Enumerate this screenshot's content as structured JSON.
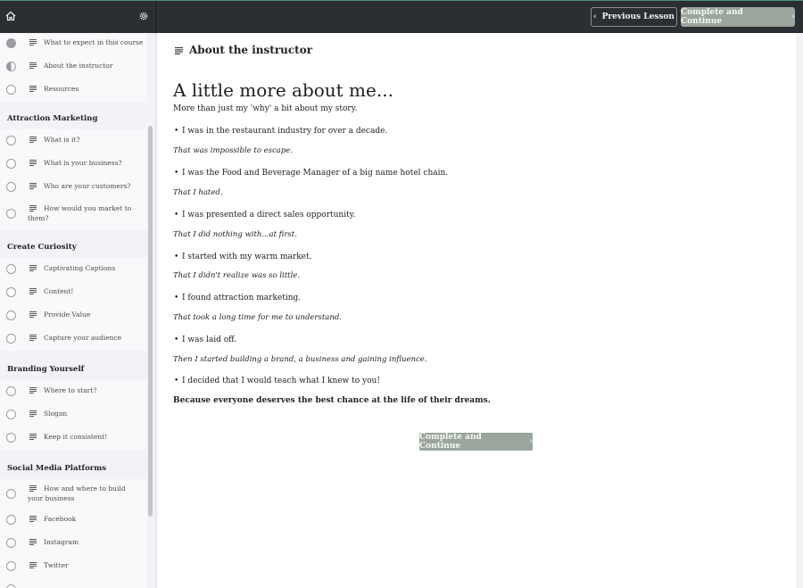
{
  "topbar": {
    "prev_label": "Previous Lesson",
    "complete_label": "Complete and Continue"
  },
  "sidebar": {
    "intro_lessons": [
      {
        "label": "What to expect in this course",
        "status": "done"
      },
      {
        "label": "About the instructor",
        "status": "current"
      },
      {
        "label": "Resources",
        "status": "todo"
      }
    ],
    "sections": [
      {
        "title": "Attraction Marketing",
        "lessons": [
          "What is it?",
          "What is your business?",
          "Who are your customers?",
          "How would you market to them?"
        ]
      },
      {
        "title": "Create Curiosity",
        "lessons": [
          "Captivating Captions",
          "Content!",
          "Provide Value",
          "Capture your audience"
        ]
      },
      {
        "title": "Branding Yourself",
        "lessons": [
          "Where to start?",
          "Slogan",
          "Keep it consistent!"
        ]
      },
      {
        "title": "Social Media Platforms",
        "lessons": [
          "How and where to build your business",
          "Facebook",
          "Instagram",
          "Twitter"
        ]
      }
    ]
  },
  "main": {
    "lesson_title": "About the instructor",
    "heading": "A little more about me...",
    "intro": "More than just my 'why' a bit about my story.",
    "story": [
      {
        "bullet": "I was in the restaurant industry for over a decade.",
        "note": "That was impossible to escape."
      },
      {
        "bullet": "I was the Food and Beverage Manager of a big name hotel chain.",
        "note": "That I hated."
      },
      {
        "bullet": "I was presented a direct sales opportunity.",
        "note": "That I did nothing with...at first."
      },
      {
        "bullet": "I started with my warm market.",
        "note": "That I didn't realize was so little."
      },
      {
        "bullet": "I found attraction marketing.",
        "note": "That took a long time for me to understand."
      },
      {
        "bullet": "I was laid off.",
        "note": "Then I started building a brand, a business and gaining influence."
      },
      {
        "bullet": "I decided that I would teach what I knew to you!",
        "note": ""
      }
    ],
    "closing": "Because everyone deserves the best chance at the life of their dreams.",
    "complete_label": "Complete and Continue"
  }
}
